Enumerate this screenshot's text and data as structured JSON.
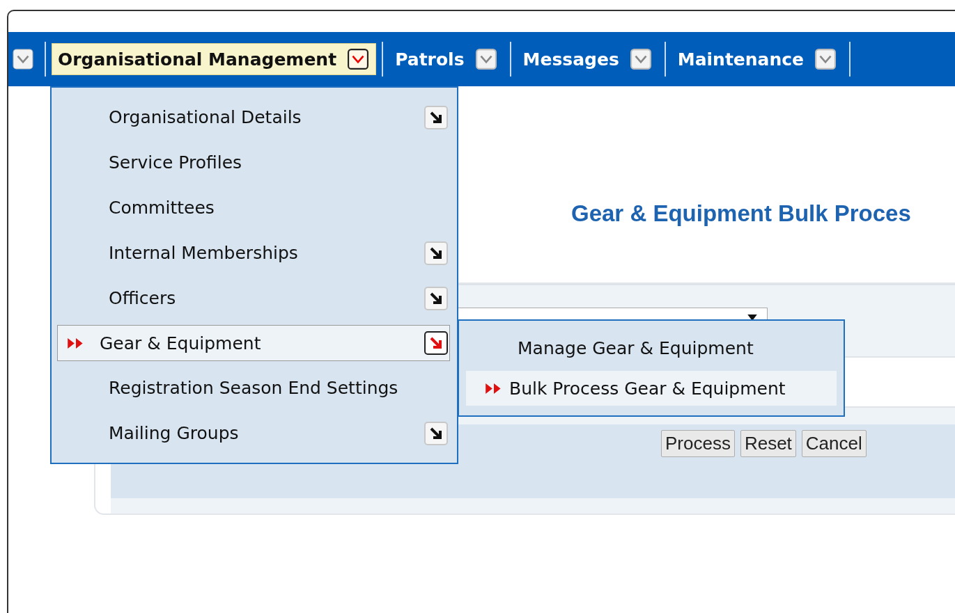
{
  "nav_menus": [
    {
      "label": "Organisational Management",
      "selected": true
    },
    {
      "label": "Patrols",
      "selected": false
    },
    {
      "label": "Messages",
      "selected": false
    },
    {
      "label": "Maintenance",
      "selected": false
    }
  ],
  "menu": {
    "items": [
      {
        "label": "Organisational Details",
        "has_submenu": true,
        "selected": false
      },
      {
        "label": "Service Profiles",
        "has_submenu": false,
        "selected": false
      },
      {
        "label": "Committees",
        "has_submenu": false,
        "selected": false
      },
      {
        "label": "Internal Memberships",
        "has_submenu": true,
        "selected": false
      },
      {
        "label": "Officers",
        "has_submenu": true,
        "selected": false
      },
      {
        "label": "Gear & Equipment",
        "has_submenu": true,
        "selected": true
      },
      {
        "label": "Registration Season End Settings",
        "has_submenu": false,
        "selected": false
      },
      {
        "label": "Mailing Groups",
        "has_submenu": true,
        "selected": false
      }
    ]
  },
  "submenu": {
    "items": [
      {
        "label": "Manage Gear & Equipment",
        "selected": false
      },
      {
        "label": "Bulk Process Gear & Equipment",
        "selected": true
      }
    ]
  },
  "page_title": "Gear & Equipment Bulk Proces",
  "buttons": [
    "Process",
    "Reset",
    "Cancel"
  ]
}
